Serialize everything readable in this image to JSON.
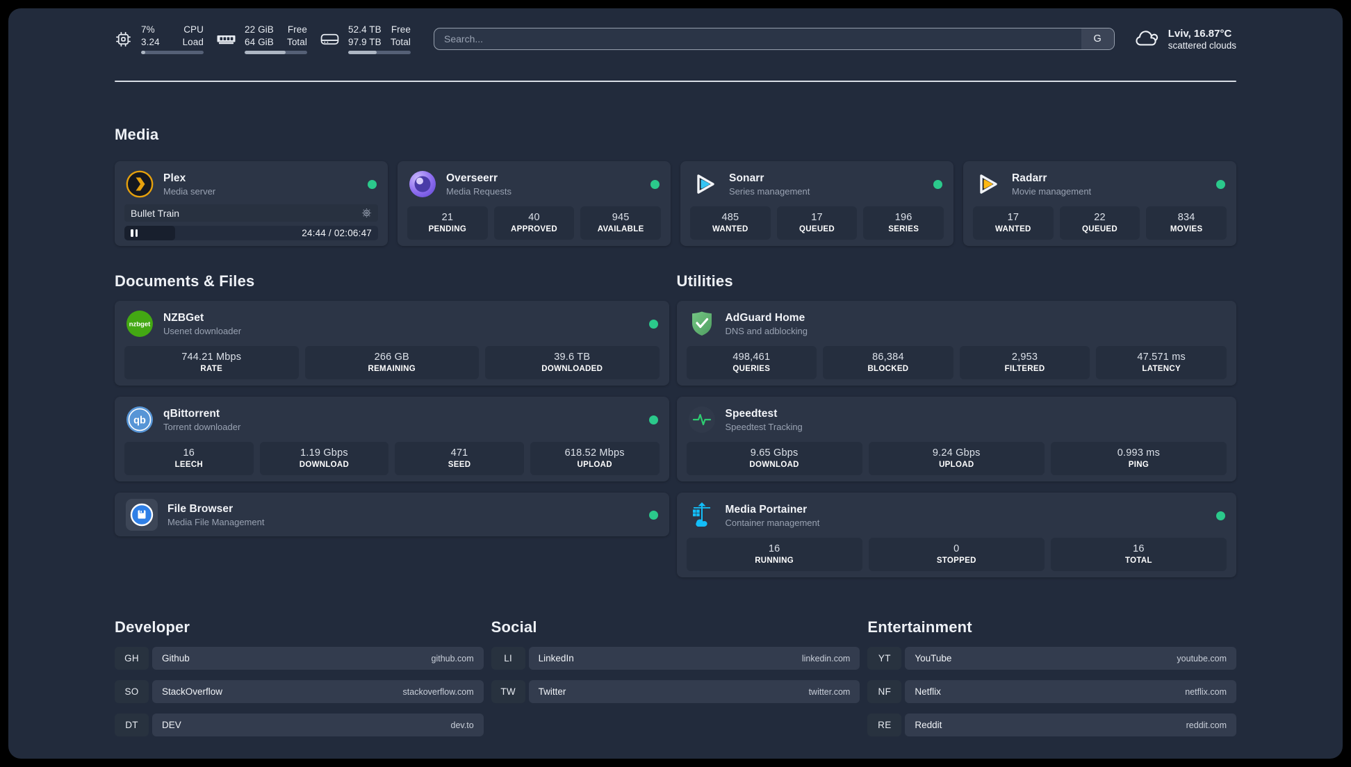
{
  "theme": {
    "page_bg": "#222b3c",
    "card_bg": "#2c3546",
    "status_green": "#2bc98b",
    "plex_amber": "#e5a00d",
    "sonarr_cyan": "#35c5f4",
    "radarr_yellow": "#fdb813",
    "nzbget_green": "#43a813",
    "qbittorrent_blue": "#5795d6",
    "adguard_green": "#63b873",
    "speedtest_green": "#2ecc71",
    "portainer_blue": "#13bef9"
  },
  "icons": {
    "cpu-icon": "chip outline",
    "memory-icon": "ram stick",
    "disk-icon": "hard drive",
    "search-provider-button": "G",
    "weather-icon": "cloud outline",
    "gear-icon": "gear",
    "pause-icon": "two bars",
    "status-dot": "green circle"
  },
  "header": {
    "resources": [
      {
        "name": "cpu",
        "top_value": "7%",
        "bottom_value": "3.24",
        "top_label": "CPU",
        "bottom_label": "Load",
        "progress_pct": 7
      },
      {
        "name": "memory",
        "top_value": "22 GiB",
        "bottom_value": "64 GiB",
        "top_label": "Free",
        "bottom_label": "Total",
        "progress_pct": 66
      },
      {
        "name": "disk",
        "top_value": "52.4 TB",
        "bottom_value": "97.9 TB",
        "top_label": "Free",
        "bottom_label": "Total",
        "progress_pct": 46
      }
    ],
    "search": {
      "placeholder": "Search...",
      "provider_button": "G"
    },
    "weather": {
      "location": "Lviv, 16.87°C",
      "condition": "scattered clouds"
    }
  },
  "sections": {
    "media": {
      "title": "Media",
      "plex": {
        "name": "Plex",
        "description": "Media server",
        "now_playing": {
          "title": "Bullet Train",
          "time": "24:44 / 02:06:47",
          "progress_pct": 20
        }
      },
      "overseerr": {
        "name": "Overseerr",
        "description": "Media Requests",
        "stats": [
          {
            "value": "21",
            "label": "PENDING"
          },
          {
            "value": "40",
            "label": "APPROVED"
          },
          {
            "value": "945",
            "label": "AVAILABLE"
          }
        ]
      },
      "sonarr": {
        "name": "Sonarr",
        "description": "Series management",
        "stats": [
          {
            "value": "485",
            "label": "WANTED"
          },
          {
            "value": "17",
            "label": "QUEUED"
          },
          {
            "value": "196",
            "label": "SERIES"
          }
        ]
      },
      "radarr": {
        "name": "Radarr",
        "description": "Movie management",
        "stats": [
          {
            "value": "17",
            "label": "WANTED"
          },
          {
            "value": "22",
            "label": "QUEUED"
          },
          {
            "value": "834",
            "label": "MOVIES"
          }
        ]
      }
    },
    "documents": {
      "title": "Documents & Files",
      "nzbget": {
        "name": "NZBGet",
        "description": "Usenet downloader",
        "icon_text": "nzbget",
        "stats": [
          {
            "value": "744.21 Mbps",
            "label": "RATE"
          },
          {
            "value": "266 GB",
            "label": "REMAINING"
          },
          {
            "value": "39.6 TB",
            "label": "DOWNLOADED"
          }
        ]
      },
      "qbittorrent": {
        "name": "qBittorrent",
        "description": "Torrent downloader",
        "icon_text": "qb",
        "stats": [
          {
            "value": "16",
            "label": "LEECH"
          },
          {
            "value": "1.19 Gbps",
            "label": "DOWNLOAD"
          },
          {
            "value": "471",
            "label": "SEED"
          },
          {
            "value": "618.52 Mbps",
            "label": "UPLOAD"
          }
        ]
      },
      "filebrowser": {
        "name": "File Browser",
        "description": "Media File Management"
      }
    },
    "utilities": {
      "title": "Utilities",
      "adguard": {
        "name": "AdGuard Home",
        "description": "DNS and adblocking",
        "stats": [
          {
            "value": "498,461",
            "label": "QUERIES"
          },
          {
            "value": "86,384",
            "label": "BLOCKED"
          },
          {
            "value": "2,953",
            "label": "FILTERED"
          },
          {
            "value": "47.571 ms",
            "label": "LATENCY"
          }
        ]
      },
      "speedtest": {
        "name": "Speedtest",
        "description": "Speedtest Tracking",
        "stats": [
          {
            "value": "9.65 Gbps",
            "label": "DOWNLOAD"
          },
          {
            "value": "9.24 Gbps",
            "label": "UPLOAD"
          },
          {
            "value": "0.993 ms",
            "label": "PING"
          }
        ]
      },
      "portainer": {
        "name": "Media Portainer",
        "description": "Container management",
        "stats": [
          {
            "value": "16",
            "label": "RUNNING"
          },
          {
            "value": "0",
            "label": "STOPPED"
          },
          {
            "value": "16",
            "label": "TOTAL"
          }
        ]
      }
    }
  },
  "bookmarks": {
    "groups": [
      {
        "title": "Developer",
        "items": [
          {
            "abbr": "GH",
            "name": "Github",
            "domain": "github.com"
          },
          {
            "abbr": "SO",
            "name": "StackOverflow",
            "domain": "stackoverflow.com"
          },
          {
            "abbr": "DT",
            "name": "DEV",
            "domain": "dev.to"
          }
        ]
      },
      {
        "title": "Social",
        "items": [
          {
            "abbr": "LI",
            "name": "LinkedIn",
            "domain": "linkedin.com"
          },
          {
            "abbr": "TW",
            "name": "Twitter",
            "domain": "twitter.com"
          }
        ]
      },
      {
        "title": "Entertainment",
        "items": [
          {
            "abbr": "YT",
            "name": "YouTube",
            "domain": "youtube.com"
          },
          {
            "abbr": "NF",
            "name": "Netflix",
            "domain": "netflix.com"
          },
          {
            "abbr": "RE",
            "name": "Reddit",
            "domain": "reddit.com"
          }
        ]
      }
    ]
  }
}
